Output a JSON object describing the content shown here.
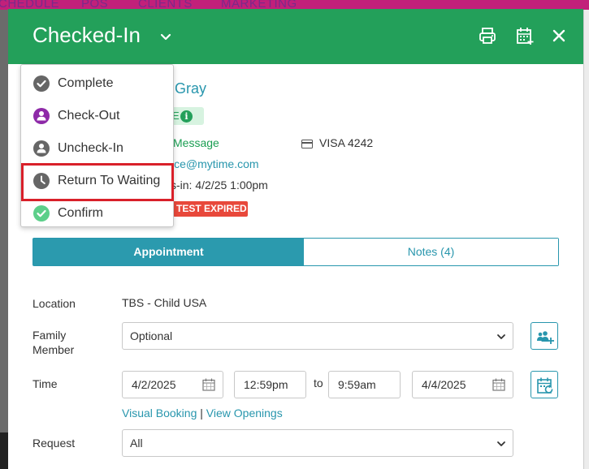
{
  "background": {
    "nav": [
      "CHEDULE",
      "POS",
      "CLIENTS",
      "MARKETING"
    ]
  },
  "header": {
    "title": "Checked-In",
    "icons": [
      "printer-icon",
      "calendar-add-icon",
      "close-icon"
    ]
  },
  "status_menu": {
    "items": [
      {
        "label": "Complete",
        "icon": "check-circle-icon",
        "color": "#666666"
      },
      {
        "label": "Check-Out",
        "icon": "person-circle-icon",
        "color": "#8e2aa8"
      },
      {
        "label": "Uncheck-In",
        "icon": "person-circle-icon",
        "color": "#666666"
      },
      {
        "label": "Return To Waiting",
        "icon": "clock-icon",
        "color": "#666666",
        "highlighted": true
      },
      {
        "label": "Confirm",
        "icon": "check-circle-icon",
        "color": "#5ccf8a"
      }
    ]
  },
  "client": {
    "name_fragment": "e Gray",
    "status_fragment": "E",
    "message_fragment": "Message",
    "card": "VISA 4242",
    "email_fragment": "ice@mytime.com",
    "checkin_fragment": "s-in: 4/2/25 1:00pm",
    "badge": "TEST EXPIRED"
  },
  "tabs": [
    {
      "label": "Appointment",
      "active": true
    },
    {
      "label": "Notes (4)",
      "active": false
    }
  ],
  "form": {
    "location": {
      "label": "Location",
      "value": "TBS - Child USA"
    },
    "family_member": {
      "label_line1": "Family",
      "label_line2": "Member",
      "value": "Optional"
    },
    "time": {
      "label": "Time",
      "start_date": "4/2/2025",
      "start_time": "12:59pm",
      "to": "to",
      "end_time": "9:59am",
      "end_date": "4/4/2025"
    },
    "links": {
      "visual_booking": "Visual Booking",
      "separator": "|",
      "view_openings": "View Openings"
    },
    "request": {
      "label": "Request",
      "value": "All"
    }
  },
  "colors": {
    "header": "#23a05a",
    "accent": "#2896ad",
    "danger": "#e8483b",
    "highlight_border": "#d9202a"
  }
}
